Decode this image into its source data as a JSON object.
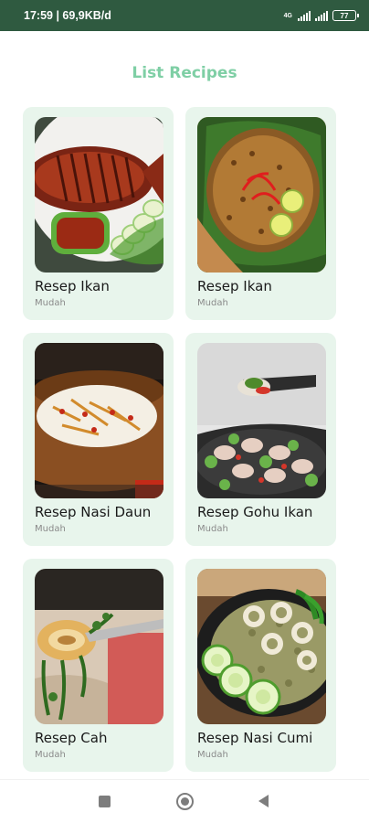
{
  "status_bar": {
    "time_speed": "17:59 | 69,9KB/d",
    "signal_label": "4G",
    "battery": "77"
  },
  "page": {
    "title": "List Recipes"
  },
  "recipes": [
    {
      "title": "Resep Ikan",
      "difficulty": "Mudah",
      "image": "grilled-fish-photo"
    },
    {
      "title": "Resep Ikan",
      "difficulty": "Mudah",
      "image": "fish-rice-banana-leaf-photo"
    },
    {
      "title": "Resep Nasi Daun",
      "difficulty": "Mudah",
      "image": "rice-bowl-photo"
    },
    {
      "title": "Resep Gohu Ikan",
      "difficulty": "Mudah",
      "image": "raw-fish-salad-photo"
    },
    {
      "title": "Resep Cah",
      "difficulty": "Mudah",
      "image": "squid-stir-fry-photo"
    },
    {
      "title": "Resep Nasi Cumi",
      "difficulty": "Mudah",
      "image": "squid-rice-photo"
    }
  ],
  "nav": {
    "recent_icon": "square-icon",
    "home_icon": "circle-icon",
    "back_icon": "triangle-back-icon"
  },
  "colors": {
    "status_bar": "#2f5a40",
    "title": "#7fcfa5",
    "card_bg": "#e8f5ec"
  }
}
